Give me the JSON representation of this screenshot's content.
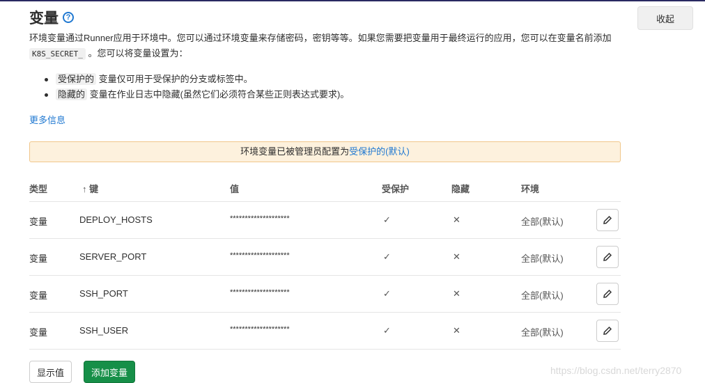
{
  "title": "变量",
  "collapse_label": "收起",
  "desc_1": "环境变量通过Runner应用于环境中。您可以通过环境变量来存储密码，密钥等等。如果您需要把变量用于最终运行的应用，您可以在变量名前添加",
  "desc_code": "K8S_SECRET_",
  "desc_2": "。您可以将变量设置为：",
  "bullets": [
    {
      "tag": "受保护的",
      "text": "变量仅可用于受保护的分支或标签中。"
    },
    {
      "tag": "隐藏的",
      "text": "变量在作业日志中隐藏(虽然它们必须符合某些正则表达式要求)。"
    }
  ],
  "more_info": "更多信息",
  "alert": {
    "text": "环境变量已被管理员配置为",
    "link": "受保护的(默认)"
  },
  "headers": {
    "type": "类型",
    "key": "↑ 键",
    "value": "值",
    "protected": "受保护",
    "masked": "隐藏",
    "env": "环境"
  },
  "rows": [
    {
      "type": "变量",
      "key": "DEPLOY_HOSTS",
      "value": "********************",
      "protected": "✓",
      "masked": "✕",
      "env": "全部(默认)"
    },
    {
      "type": "变量",
      "key": "SERVER_PORT",
      "value": "********************",
      "protected": "✓",
      "masked": "✕",
      "env": "全部(默认)"
    },
    {
      "type": "变量",
      "key": "SSH_PORT",
      "value": "********************",
      "protected": "✓",
      "masked": "✕",
      "env": "全部(默认)"
    },
    {
      "type": "变量",
      "key": "SSH_USER",
      "value": "********************",
      "protected": "✓",
      "masked": "✕",
      "env": "全部(默认)"
    }
  ],
  "reveal_label": "显示值",
  "add_label": "添加变量",
  "watermark": "https://blog.csdn.net/terry2870"
}
